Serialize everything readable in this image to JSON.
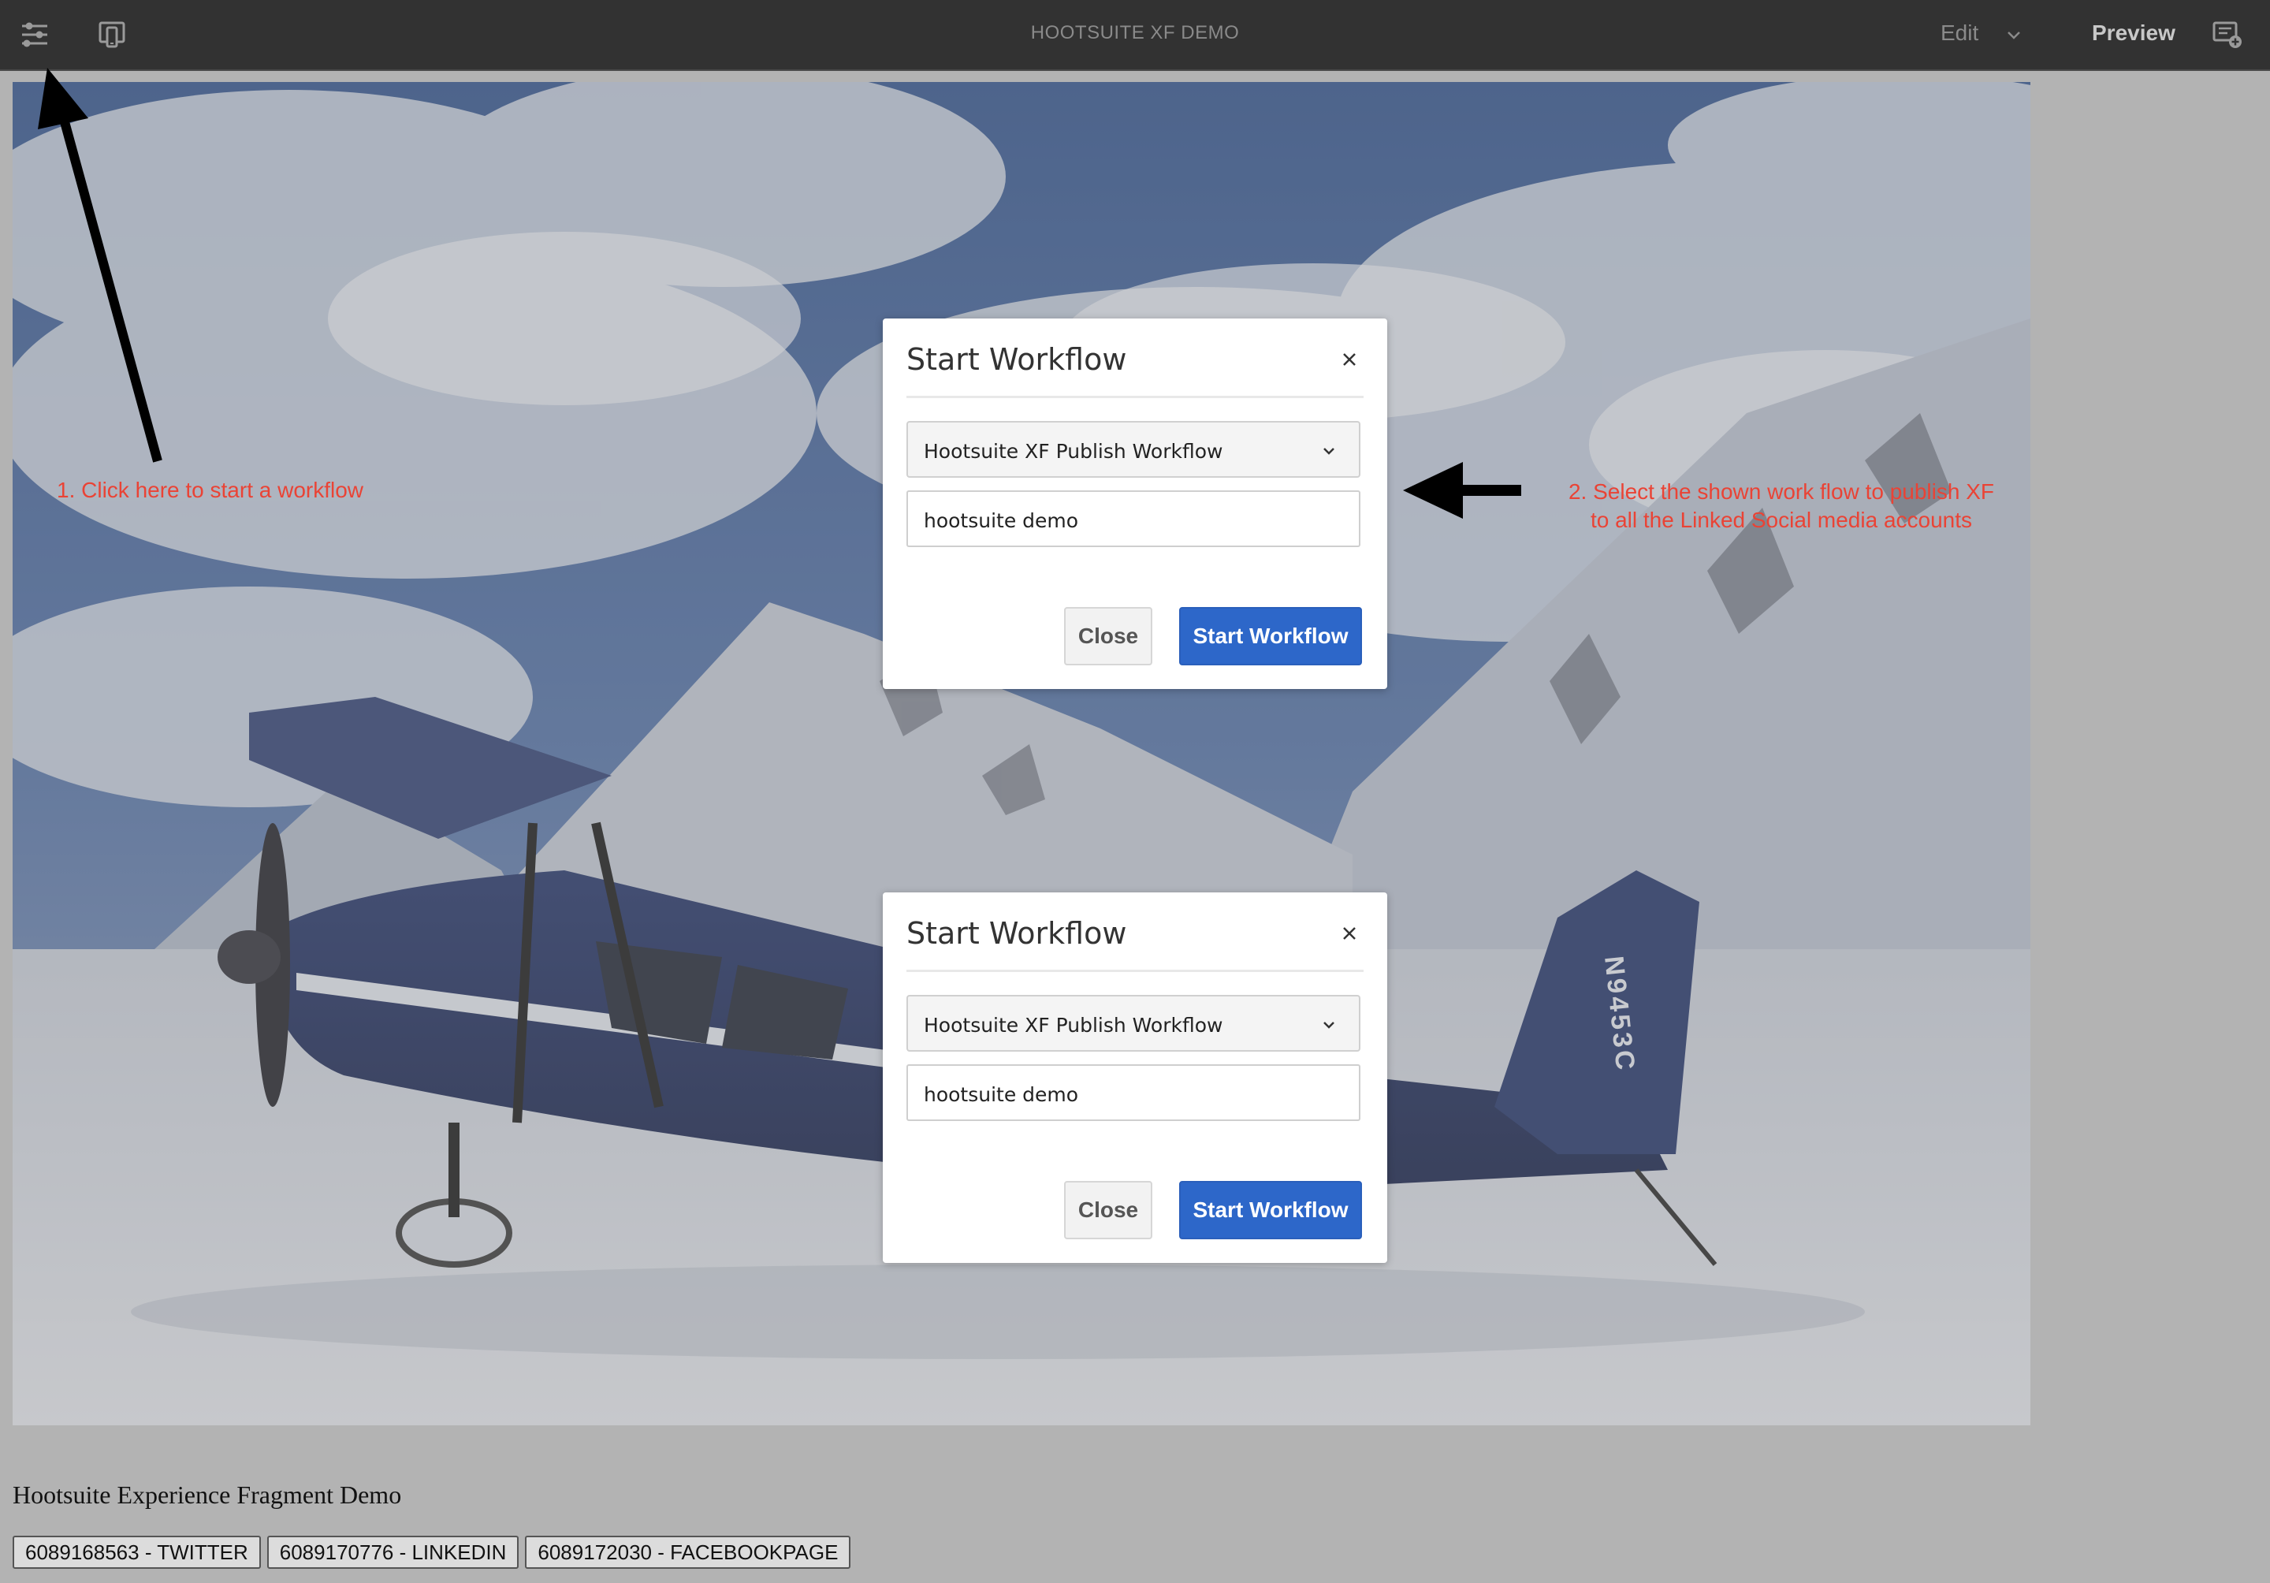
{
  "toolbar": {
    "title": "HOOTSUITE XF DEMO",
    "edit_label": "Edit",
    "preview_label": "Preview",
    "icons": [
      "sliders-icon",
      "device-preview-icon",
      "chevron-down-icon",
      "comment-add-icon"
    ]
  },
  "dialogs": [
    {
      "title": "Start Workflow",
      "workflow_select": "Hootsuite XF Publish Workflow",
      "title_input": "hootsuite demo",
      "close_label": "Close",
      "start_label": "Start Workflow"
    },
    {
      "title": "Start Workflow",
      "workflow_select": "Hootsuite XF Publish Workflow",
      "title_input": "hootsuite demo",
      "close_label": "Close",
      "start_label": "Start Workflow"
    }
  ],
  "annotations": {
    "step1": "1. Click here to start a workflow",
    "step2_line1": "2. Select the shown work flow to publish XF",
    "step2_line2": "to all the Linked Social media accounts"
  },
  "hero": {
    "tail_number": "N9453C"
  },
  "content": {
    "heading": "Hootsuite Experience Fragment Demo",
    "accounts": [
      "6089168563 - TWITTER",
      "6089170776 - LINKEDIN",
      "6089172030 - FACEBOOKPAGE"
    ]
  },
  "colors": {
    "toolbar_bg": "#323232",
    "primary_button": "#2d67c9",
    "annotation_red": "#ea4335",
    "overlay_gray": "#b3b3b3"
  }
}
